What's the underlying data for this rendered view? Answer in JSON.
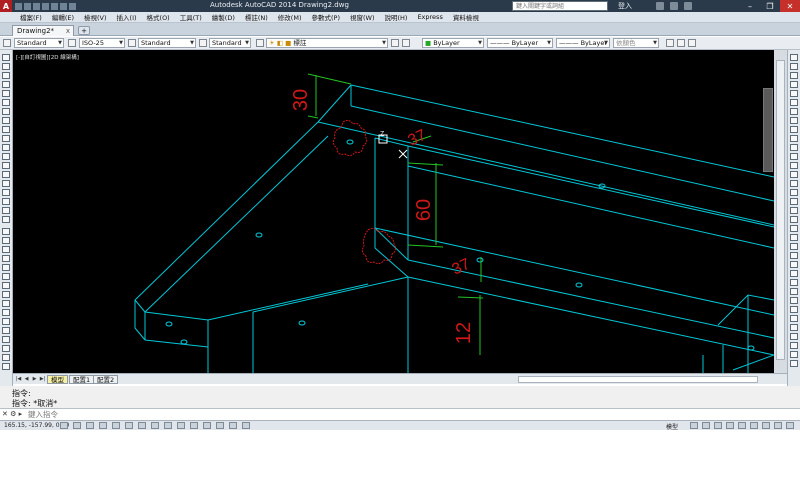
{
  "titlebar": {
    "logo": "A",
    "title": "Autodesk AutoCAD 2014    Drawing2.dwg",
    "search_placeholder": "鍵入關鍵字或詞組",
    "login": "登入",
    "minimize": "–",
    "restore": "❐",
    "close": "✕"
  },
  "menu": [
    "檔案(F)",
    "編輯(E)",
    "檢視(V)",
    "插入(I)",
    "格式(O)",
    "工具(T)",
    "繪製(D)",
    "標註(N)",
    "修改(M)",
    "參數式(P)",
    "視窗(W)",
    "說明(H)",
    "Express",
    "資料檢視"
  ],
  "tabs": {
    "active": "Drawing2*",
    "close": "x",
    "new_tab": "+"
  },
  "properties_toolbar": {
    "text_style": "Standard",
    "dim_style": "ISO-25",
    "table_style": "Standard",
    "mleader_style": "Standard",
    "layer": "標註",
    "color": "ByLayer",
    "linetype": "ByLayer",
    "lineweight": "ByLayer",
    "plot_style": "依顏色"
  },
  "viewport": {
    "label": "[-][自訂視圖][2D 線架構]",
    "dimensions": [
      "30",
      "37",
      "60",
      "37",
      "12"
    ],
    "ucs_label": "Z"
  },
  "layout_tabs": {
    "nav": [
      "|◀",
      "◀",
      "▶",
      "▶|"
    ],
    "tabs": [
      "模型",
      "配置1",
      "配置2"
    ]
  },
  "command": {
    "history": [
      "指令:",
      "指令:  *取消*"
    ],
    "input_placeholder": "鍵入指令",
    "controls": "✕ ⚙ ▸"
  },
  "status": {
    "coordinates": "165.15, -157.99, 0.00",
    "model": "模型"
  },
  "colors": {
    "geometry": "#00c8d8",
    "dimension": "#d01818",
    "dim_lines": "#22c422",
    "background": "#000000"
  }
}
